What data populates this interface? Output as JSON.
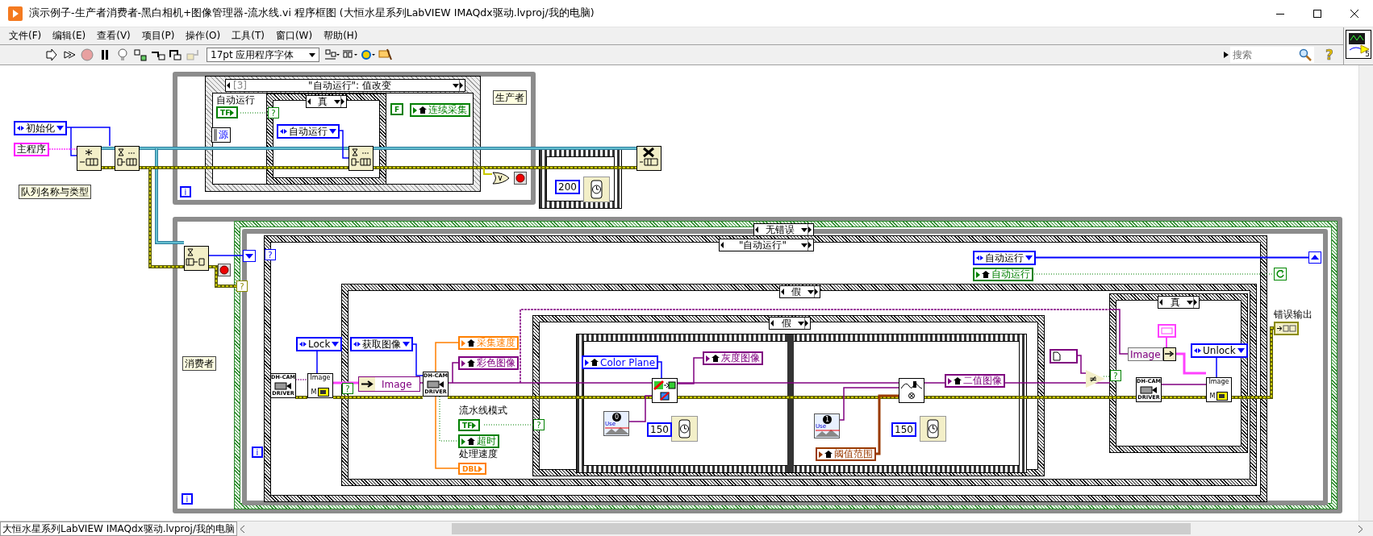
{
  "window": {
    "title": "演示例子-生产者消费者-黑白相机+图像管理器-流水线.vi 程序框图 (大恒水星系列LabVIEW IMAQdx驱动.lvproj/我的电脑)"
  },
  "menu": [
    "文件(F)",
    "编辑(E)",
    "查看(V)",
    "项目(P)",
    "操作(O)",
    "工具(T)",
    "窗口(W)",
    "帮助(H)"
  ],
  "toolbar": {
    "font": "17pt 应用程序字体",
    "search": {
      "placeholder": "搜索"
    },
    "help": "?",
    "vi_icon_badge": "5"
  },
  "diagram": {
    "structures": [
      {
        "kind": "while_loop"
      },
      {
        "kind": "event_structure",
        "selector_index": "[3]",
        "selector": "\"自动运行\": 值改变"
      },
      {
        "kind": "case_structure",
        "selector": "真"
      },
      {
        "kind": "flat_sequence"
      },
      {
        "kind": "while_loop"
      },
      {
        "kind": "error_case",
        "selector": "无错误"
      },
      {
        "kind": "while_loop"
      },
      {
        "kind": "case_structure",
        "selector": "\"自动运行\""
      },
      {
        "kind": "case_structure",
        "selector": "假"
      },
      {
        "kind": "case_structure",
        "selector": "假"
      },
      {
        "kind": "flat_sequence"
      },
      {
        "kind": "case_structure",
        "selector": "真"
      }
    ],
    "items": [
      {
        "kind": "enum",
        "text": "初始化"
      },
      {
        "kind": "string",
        "text": "主程序"
      },
      {
        "kind": "label",
        "text": "队列名称与类型"
      },
      {
        "kind": "caption",
        "text": "自动运行"
      },
      {
        "kind": "terminal",
        "text": "TF",
        "color": "#008000"
      },
      {
        "kind": "event_data",
        "text": "源"
      },
      {
        "kind": "enum",
        "text": "自动运行"
      },
      {
        "kind": "bool_const",
        "text": "F"
      },
      {
        "kind": "local",
        "text": "连续采集",
        "color": "#008000"
      },
      {
        "kind": "label",
        "text": "生产者"
      },
      {
        "kind": "numeric",
        "text": "200"
      },
      {
        "kind": "iteration",
        "text": "i"
      },
      {
        "kind": "condition",
        "text": "?",
        "color": "#008000"
      },
      {
        "kind": "enum",
        "text": "自动运行"
      },
      {
        "kind": "local",
        "text": "自动运行",
        "color": "#008000"
      },
      {
        "kind": "label",
        "text": "消费者"
      },
      {
        "kind": "condition",
        "text": "?",
        "color": "#0000ff"
      },
      {
        "kind": "condition",
        "text": "?",
        "color": "#8b8b00"
      },
      {
        "kind": "enum",
        "text": "Lock"
      },
      {
        "kind": "camera_driver",
        "top": "DH-CAM",
        "bottom": "DRIVER"
      },
      {
        "kind": "image_manager",
        "top": "Image",
        "bottom": "M"
      },
      {
        "kind": "condition",
        "text": "?",
        "color": "#008000"
      },
      {
        "kind": "enum",
        "text": "获取图像"
      },
      {
        "kind": "indicator",
        "text": "Image",
        "color": "#800080"
      },
      {
        "kind": "camera_driver",
        "top": "DH-CAM",
        "bottom": "DRIVER"
      },
      {
        "kind": "local",
        "text": "采集速度",
        "color": "#ff7f00"
      },
      {
        "kind": "local",
        "text": "彩色图像",
        "color": "#800080"
      },
      {
        "kind": "caption",
        "text": "流水线模式"
      },
      {
        "kind": "terminal",
        "text": "TF",
        "color": "#008000"
      },
      {
        "kind": "local",
        "text": "超时",
        "color": "#008000"
      },
      {
        "kind": "caption",
        "text": "处理速度"
      },
      {
        "kind": "terminal",
        "text": "DBL",
        "color": "#ff7f00"
      },
      {
        "kind": "condition",
        "text": "?",
        "color": "#008000"
      },
      {
        "kind": "local",
        "text": "Color Plane",
        "color": "#0000ff"
      },
      {
        "kind": "image_source",
        "digit": "0",
        "text": "Use"
      },
      {
        "kind": "numeric",
        "text": "150"
      },
      {
        "kind": "local",
        "text": "灰度图像",
        "color": "#800080"
      },
      {
        "kind": "image_source",
        "digit": "1",
        "text": "Use"
      },
      {
        "kind": "local",
        "text": "阈值范围",
        "color": "#9a3a00"
      },
      {
        "kind": "numeric",
        "text": "150"
      },
      {
        "kind": "local",
        "text": "二值图像",
        "color": "#800080"
      },
      {
        "kind": "not_equal",
        "text": "≠"
      },
      {
        "kind": "condition",
        "text": "?",
        "color": "#008000"
      },
      {
        "kind": "unbundle",
        "text": "Image"
      },
      {
        "kind": "enum",
        "text": "Unlock"
      },
      {
        "kind": "camera_driver",
        "top": "DH-CAM",
        "bottom": "DRIVER"
      },
      {
        "kind": "image_manager",
        "top": "Image",
        "bottom": "M"
      },
      {
        "kind": "caption",
        "text": "错误输出"
      },
      {
        "kind": "iteration",
        "text": "i"
      },
      {
        "kind": "iteration",
        "text": "i"
      }
    ]
  },
  "status_bar": {
    "path": "大恒水星系列LabVIEW IMAQdx驱动.lvproj/我的电脑"
  }
}
